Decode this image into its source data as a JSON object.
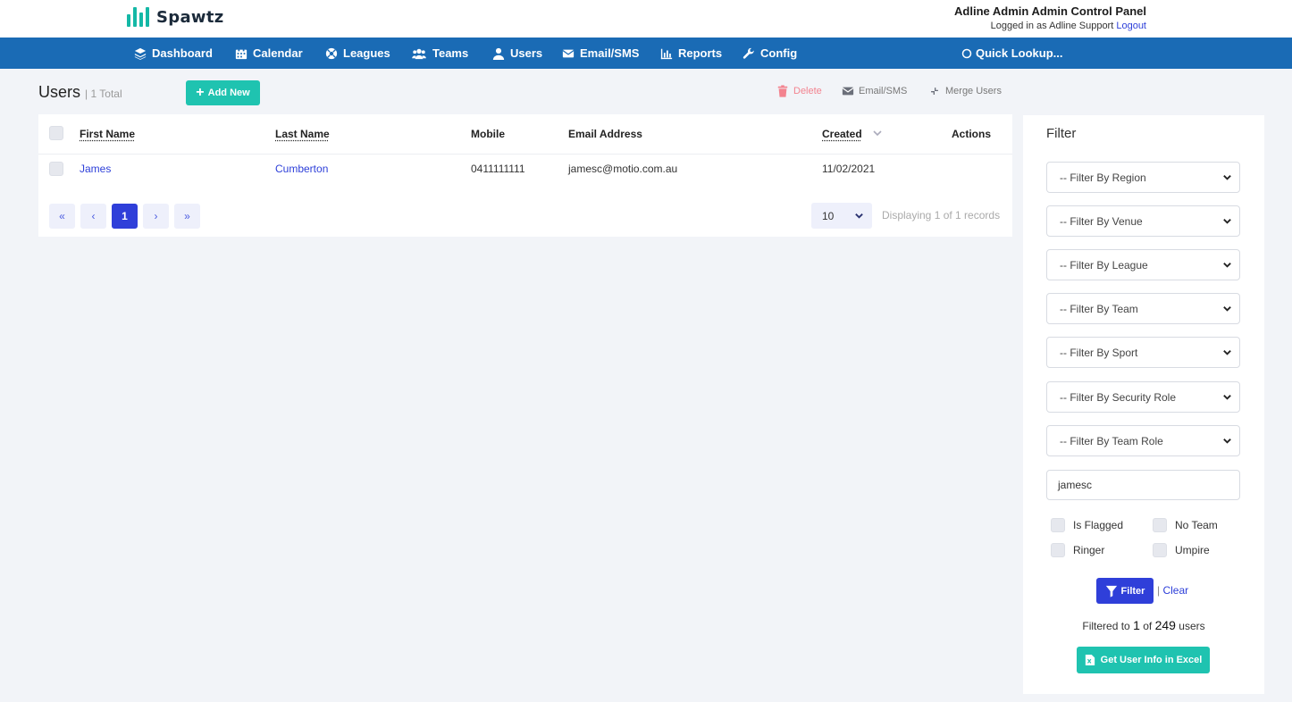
{
  "header": {
    "logo_text": "Spawtz",
    "panel_title": "Adline Admin Admin Control Panel",
    "logged_in_prefix": "Logged in as Adline Support",
    "logout_label": "Logout"
  },
  "nav": {
    "items": [
      {
        "label": "Dashboard",
        "icon": "layers-icon"
      },
      {
        "label": "Calendar",
        "icon": "calendar-icon"
      },
      {
        "label": "Leagues",
        "icon": "ball-icon"
      },
      {
        "label": "Teams",
        "icon": "users-group-icon"
      },
      {
        "label": "Users",
        "icon": "user-icon"
      },
      {
        "label": "Email/SMS",
        "icon": "envelope-icon"
      },
      {
        "label": "Reports",
        "icon": "bar-chart-icon"
      },
      {
        "label": "Config",
        "icon": "wrench-icon"
      }
    ],
    "quick_lookup": "Quick Lookup..."
  },
  "page": {
    "title": "Users",
    "count": "| 1 Total",
    "add_new_label": "Add New",
    "actions": {
      "delete": "Delete",
      "email": "Email/SMS",
      "merge": "Merge Users"
    }
  },
  "table": {
    "columns": [
      "First Name",
      "Last Name",
      "Mobile",
      "Email Address",
      "Created",
      "Actions"
    ],
    "rows": [
      {
        "first_name": "James",
        "last_name": "Cumberton",
        "mobile": "0411111111",
        "email": "jamesc@motio.com.au",
        "created": "11/02/2021"
      }
    ],
    "pager": {
      "first": "«",
      "prev": "‹",
      "current": "1",
      "next": "›",
      "last": "»",
      "page_size": "10",
      "displaying": "Displaying 1 of 1 records"
    }
  },
  "filter": {
    "title": "Filter",
    "selects": [
      "-- Filter By Region",
      "-- Filter By Venue",
      "-- Filter By League",
      "-- Filter By Team",
      "-- Filter By Sport",
      "-- Filter By Security Role",
      "-- Filter By Team Role"
    ],
    "search_value": "jamesc",
    "checks": {
      "flagged": "Is Flagged",
      "no_team": "No Team",
      "ringer": "Ringer",
      "umpire": "Umpire"
    },
    "filter_button": "Filter",
    "clear_label": "Clear",
    "filtered_prefix": "Filtered to",
    "filtered_count": "1",
    "filtered_of": "of",
    "filtered_total": "249",
    "filtered_suffix": "users",
    "excel_button": "Get User Info in Excel"
  },
  "colors": {
    "nav": "#1a6bb5",
    "accent_teal": "#1fc3b0",
    "primary": "#2f3fd9",
    "danger": "#f3838f"
  }
}
